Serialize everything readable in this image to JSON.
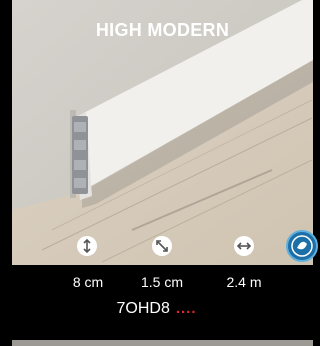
{
  "product": {
    "title": "HIGH MODERN",
    "code": "7OHD8",
    "dots": "....",
    "colors": {
      "dots": "#e0262a",
      "badge": "#1d6fa8"
    }
  },
  "specs": [
    {
      "icon": "height-arrows-icon",
      "value": "8 cm"
    },
    {
      "icon": "thickness-diagonal-icon",
      "value": "1.5 cm"
    },
    {
      "icon": "length-arrows-icon",
      "value": "2.4 m"
    }
  ],
  "badge": {
    "icon": "eco-certification-badge-icon"
  }
}
